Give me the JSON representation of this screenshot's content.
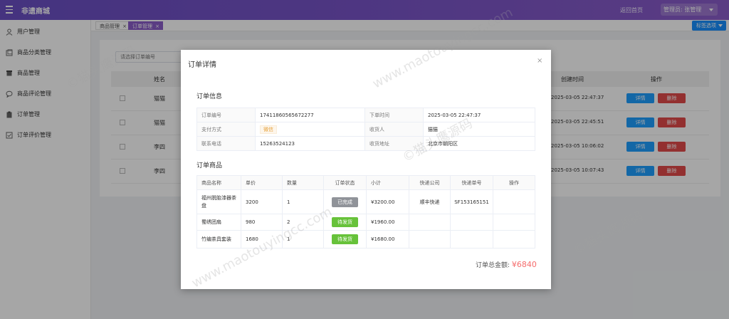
{
  "header": {
    "brand": "非遗商城",
    "home_link": "返回首页",
    "user_menu": "管理员: 张管理"
  },
  "sidebar": {
    "items": [
      {
        "label": "用户管理",
        "icon": "user-icon"
      },
      {
        "label": "商品分类管理",
        "icon": "folder-icon"
      },
      {
        "label": "商品管理",
        "icon": "box-icon"
      },
      {
        "label": "商品评论管理",
        "icon": "comment-icon"
      },
      {
        "label": "订单管理",
        "icon": "clipboard-icon"
      },
      {
        "label": "订单评价管理",
        "icon": "check-square-icon"
      }
    ]
  },
  "tabs": {
    "items": [
      {
        "label": "商品管理",
        "close": "×"
      },
      {
        "label": "订单管理",
        "close": "×"
      }
    ],
    "options_label": "标签选项"
  },
  "list": {
    "search_placeholder": "请选择订单编号",
    "columns": {
      "name": "姓名",
      "created": "创建时间",
      "actions": "操作"
    },
    "rows": [
      {
        "name": "猫猫",
        "created": "2025-03-05 22:47:37"
      },
      {
        "name": "猫猫",
        "created": "2025-03-05 22:45:51"
      },
      {
        "name": "李四",
        "created": "2025-03-05 10:06:02"
      },
      {
        "name": "李四",
        "created": "2025-03-05 10:07:43"
      }
    ],
    "detail_label": "详情",
    "delete_label": "删除"
  },
  "modal": {
    "title": "订单详情",
    "close": "×",
    "order_info_title": "订单信息",
    "order_info": {
      "order_no_label": "订单编号",
      "order_no": "17411860565672277",
      "order_time_label": "下单时间",
      "order_time": "2025-03-05 22:47:37",
      "pay_label": "支付方式",
      "pay": "微信",
      "receiver_label": "收货人",
      "receiver": "猫猫",
      "phone_label": "联系电话",
      "phone": "15263524123",
      "address_label": "收货地址",
      "address": "北京市朝阳区"
    },
    "goods_title": "订单商品",
    "goods_columns": [
      "商品名称",
      "单价",
      "数量",
      "订单状态",
      "小计",
      "快递公司",
      "快递单号",
      "操作"
    ],
    "goods": [
      {
        "name": "福州脱胎漆器茶盘",
        "price": "3200",
        "qty": "1",
        "status": "已完成",
        "status_color": "#909399",
        "subtotal": "¥3200.00",
        "courier": "顺丰快递",
        "tracking": "SF153165151"
      },
      {
        "name": "蜀绣团扇",
        "price": "980",
        "qty": "2",
        "status": "待发货",
        "status_color": "#67c23a",
        "subtotal": "¥1960.00",
        "courier": "",
        "tracking": ""
      },
      {
        "name": "竹编茶具套装",
        "price": "1680",
        "qty": "1",
        "status": "待发货",
        "status_color": "#67c23a",
        "subtotal": "¥1680.00",
        "courier": "",
        "tracking": ""
      }
    ],
    "total_label": "订单总金额:",
    "total_amount": "¥6840"
  },
  "watermark": {
    "site": "www.maotouyingcc.com",
    "cn": "©猫头鹰源码"
  },
  "colors": {
    "header": "#7a55c8",
    "accent": "#8a5cc9",
    "primary": "#1e9fff",
    "danger": "#e24b4b",
    "amount": "#f56c6c"
  }
}
